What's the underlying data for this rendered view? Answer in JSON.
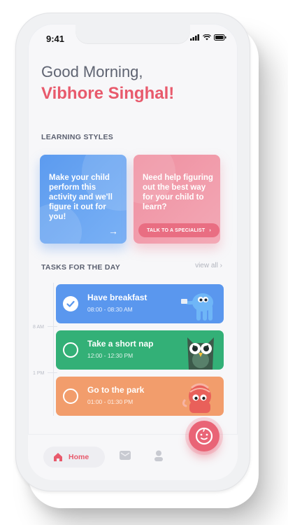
{
  "status": {
    "time": "9:41"
  },
  "greeting": "Good Morning,",
  "user_name": "Vibhore Singhal!",
  "learning_styles": {
    "title": "LEARNING STYLES",
    "cards": [
      {
        "text": "Make your child perform this activity and we'll figure it out for you!",
        "action_icon": "arrow-right-icon"
      },
      {
        "text": "Need help figuring out the best way for your child to learn?",
        "button_label": "TALK TO A SPECIALIST"
      }
    ]
  },
  "tasks": {
    "title": "TASKS FOR THE DAY",
    "view_all": "view all",
    "time_markers": [
      "8 AM",
      "1 PM"
    ],
    "items": [
      {
        "name": "Have breakfast",
        "time": "08:00 - 08:30 AM",
        "done": true,
        "color": "#5a97ee",
        "art": "elephant-icon"
      },
      {
        "name": "Take a short nap",
        "time": "12:00 - 12:30 PM",
        "done": false,
        "color": "#33b077",
        "art": "owl-icon"
      },
      {
        "name": "Go to the park",
        "time": "01:00 - 01:30 PM",
        "done": false,
        "color": "#f29d6c",
        "art": "octopus-icon"
      }
    ]
  },
  "nav": {
    "home_label": "Home",
    "items": [
      "home-icon",
      "mail-icon",
      "profile-icon"
    ],
    "fab_icon": "baby-face-icon"
  },
  "colors": {
    "accent": "#e85a6c",
    "blue": "#5c9bef",
    "pink": "#ef8fa0"
  }
}
